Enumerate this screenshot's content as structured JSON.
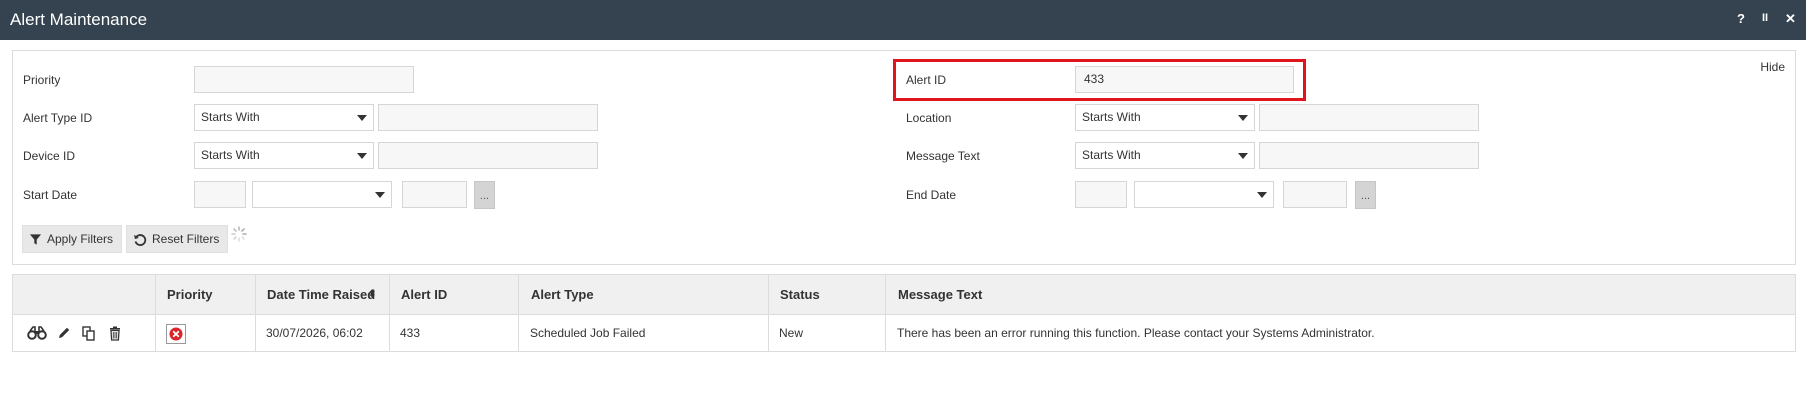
{
  "window": {
    "title": "Alert Maintenance",
    "controls": {
      "help": "?",
      "pause": "II",
      "close": "✕"
    }
  },
  "filters": {
    "hide_label": "Hide",
    "priority": {
      "label": "Priority",
      "value": ""
    },
    "alert_id": {
      "label": "Alert ID",
      "value": "433"
    },
    "alert_type_id": {
      "label": "Alert Type ID",
      "operator": "Starts With",
      "value": ""
    },
    "location": {
      "label": "Location",
      "operator": "Starts With",
      "value": ""
    },
    "device_id": {
      "label": "Device ID",
      "operator": "Starts With",
      "value": ""
    },
    "message_text": {
      "label": "Message Text",
      "operator": "Starts With",
      "value": ""
    },
    "start_date": {
      "label": "Start Date",
      "day": "",
      "month": "",
      "year": "",
      "picker": "..."
    },
    "end_date": {
      "label": "End Date",
      "day": "",
      "month": "",
      "year": "",
      "picker": "..."
    },
    "apply_label": "Apply Filters",
    "reset_label": "Reset Filters"
  },
  "table": {
    "columns": [
      "",
      "Priority",
      "Date Time Raised",
      "Alert ID",
      "Alert Type",
      "Status",
      "Message Text"
    ],
    "rows": [
      {
        "priority_icon": "error-icon",
        "date_time_raised": "30/07/2026, 06:02",
        "alert_id": "433",
        "alert_type": "Scheduled Job Failed",
        "status": "New",
        "message_text": "There has been an error running this function. Please contact your Systems Administrator."
      }
    ],
    "row_actions": [
      "binoculars-icon",
      "pencil-icon",
      "copy-icon",
      "trash-icon"
    ]
  },
  "colors": {
    "titlebar": "#34434f",
    "highlight": "#e0141c",
    "error": "#d9262b"
  }
}
